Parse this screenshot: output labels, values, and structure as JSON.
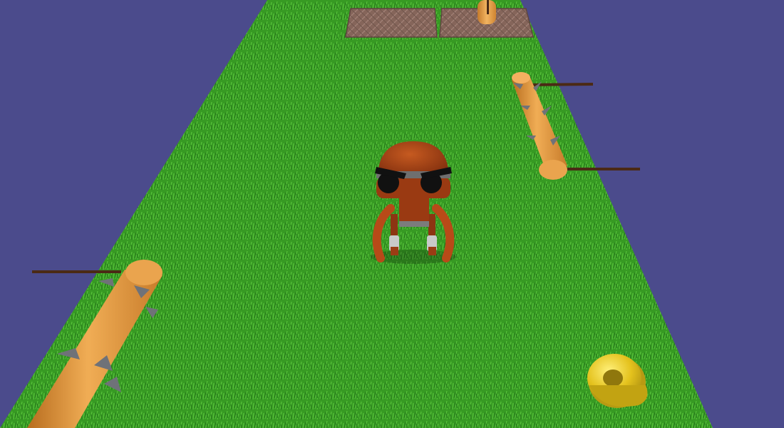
{
  "scene": {
    "sky_color": "#4b4b8c",
    "ground_texture": "grass",
    "grass_colors": [
      "#2f8a1c",
      "#3fa52a",
      "#56bf35"
    ],
    "objects": [
      "metal-floor-tiles",
      "spiked-log-obstacle",
      "robot-character",
      "gold-ring-coin"
    ]
  },
  "colors": {
    "robot_body": "#9a3a12",
    "robot_eyes": "#111111",
    "log_wood": "#e39a3f",
    "spike_metal": "#6f7278",
    "coin_gold": "#e2c21c",
    "floor_tile": "#8c6a5e"
  }
}
